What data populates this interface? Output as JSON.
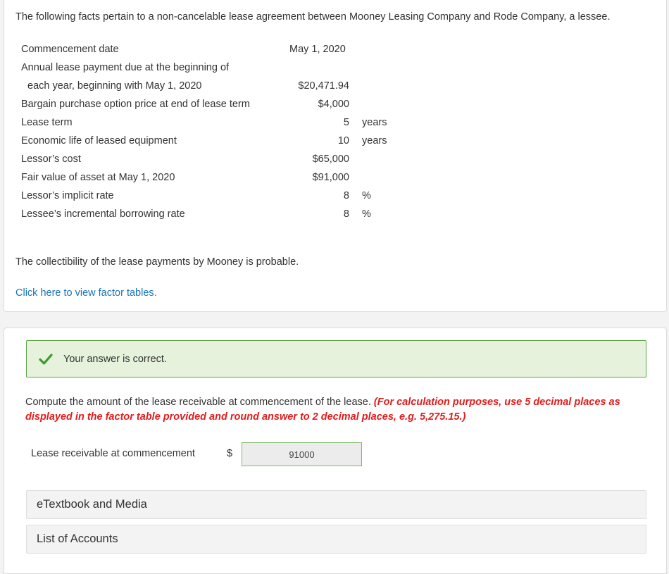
{
  "intro": "The following facts pertain to a non-cancelable lease agreement between Mooney Leasing Company and Rode Company, a lessee.",
  "facts": [
    {
      "label": "Commencement date",
      "value": "May 1, 2020",
      "unit": ""
    },
    {
      "label": "Annual lease payment due at the beginning of",
      "value": "",
      "unit": ""
    },
    {
      "label": "each year, beginning with May 1, 2020",
      "value": "$20,471.94",
      "unit": ""
    },
    {
      "label": "Bargain purchase option price at end of lease term",
      "value": "$4,000",
      "unit": ""
    },
    {
      "label": "Lease term",
      "value": "5",
      "unit": "years"
    },
    {
      "label": "Economic life of leased equipment",
      "value": "10",
      "unit": "years"
    },
    {
      "label": "Lessor’s cost",
      "value": "$65,000",
      "unit": ""
    },
    {
      "label": "Fair value of asset at May 1, 2020",
      "value": "$91,000",
      "unit": ""
    },
    {
      "label": "Lessor’s implicit rate",
      "value": "8",
      "unit": "%"
    },
    {
      "label": "Lessee’s incremental borrowing rate",
      "value": "8",
      "unit": "%"
    }
  ],
  "collectibility": "The collectibility of the lease payments by Mooney is probable.",
  "factor_link": "Click here to view factor tables.",
  "feedback": {
    "text": "Your answer is correct.",
    "icon": "check-icon",
    "color": "#5ca34a"
  },
  "question": {
    "text": "Compute the amount of the lease receivable at commencement of the lease.",
    "instruction": "(For calculation purposes, use 5 decimal places as displayed in the factor table provided and round answer to 2 decimal places, e.g. 5,275.15.)"
  },
  "answer": {
    "label": "Lease receivable at commencement",
    "currency": "$",
    "value": "91000"
  },
  "resources": {
    "etextbook": "eTextbook and Media",
    "accounts": "List of Accounts"
  }
}
